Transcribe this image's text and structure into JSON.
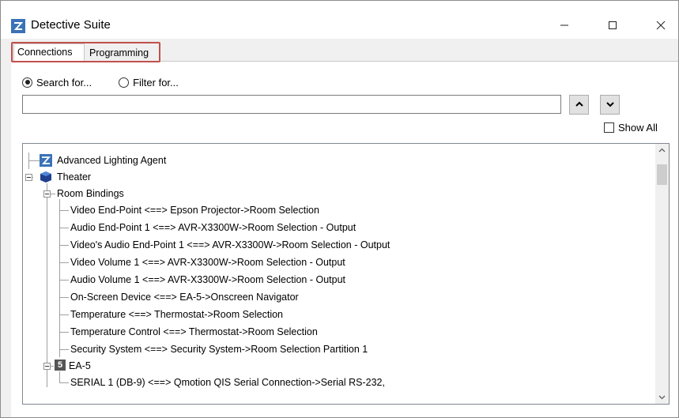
{
  "window": {
    "title": "Detective Suite",
    "icons": {
      "app": "app-logo-icon",
      "minimize": "minimize-icon",
      "maximize": "maximize-icon",
      "close": "close-icon"
    }
  },
  "tabs": [
    {
      "label": "Connections",
      "selected": true
    },
    {
      "label": "Programming",
      "selected": false
    }
  ],
  "search": {
    "mode_options": [
      {
        "label": "Search for...",
        "checked": true
      },
      {
        "label": "Filter for...",
        "checked": false
      }
    ],
    "value": "",
    "up_icon": "chevron-up-icon",
    "down_icon": "chevron-down-icon",
    "show_all_label": "Show All",
    "show_all_checked": false
  },
  "tree": {
    "nodes": [
      {
        "label": "Advanced Lighting Agent",
        "icon": "agent-icon",
        "level": 0
      },
      {
        "label": "Theater",
        "icon": "room-icon",
        "level": 0,
        "expanded": true
      },
      {
        "label": "Room Bindings",
        "level": 1,
        "expanded": true
      },
      {
        "label": "Video End-Point <==> Epson Projector->Room Selection",
        "level": 2
      },
      {
        "label": "Audio End-Point 1 <==> AVR-X3300W->Room Selection - Output",
        "level": 2
      },
      {
        "label": "Video's Audio End-Point 1 <==> AVR-X3300W->Room Selection - Output",
        "level": 2
      },
      {
        "label": "Video Volume 1 <==> AVR-X3300W->Room Selection - Output",
        "level": 2
      },
      {
        "label": "Audio Volume 1 <==> AVR-X3300W->Room Selection - Output",
        "level": 2
      },
      {
        "label": "On-Screen Device <==> EA-5->Onscreen Navigator",
        "level": 2
      },
      {
        "label": "Temperature <==> Thermostat->Room Selection",
        "level": 2
      },
      {
        "label": "Temperature Control <==> Thermostat->Room Selection",
        "level": 2
      },
      {
        "label": "Security System <==> Security System->Room Selection Partition 1",
        "level": 2
      },
      {
        "label": "EA-5",
        "icon": "controller-icon",
        "icon_text": "5",
        "level": 1,
        "expanded": true
      },
      {
        "label": "SERIAL 1 (DB-9) <==> Qmotion QIS Serial Connection->Serial RS-232,",
        "level": 2
      }
    ],
    "scroll_position": 0.05
  },
  "colors": {
    "tab_highlight": "#c0504d",
    "agent_icon": "#3a72b8",
    "room_icon": "#1f3f8f",
    "controller_icon": "#555555"
  }
}
